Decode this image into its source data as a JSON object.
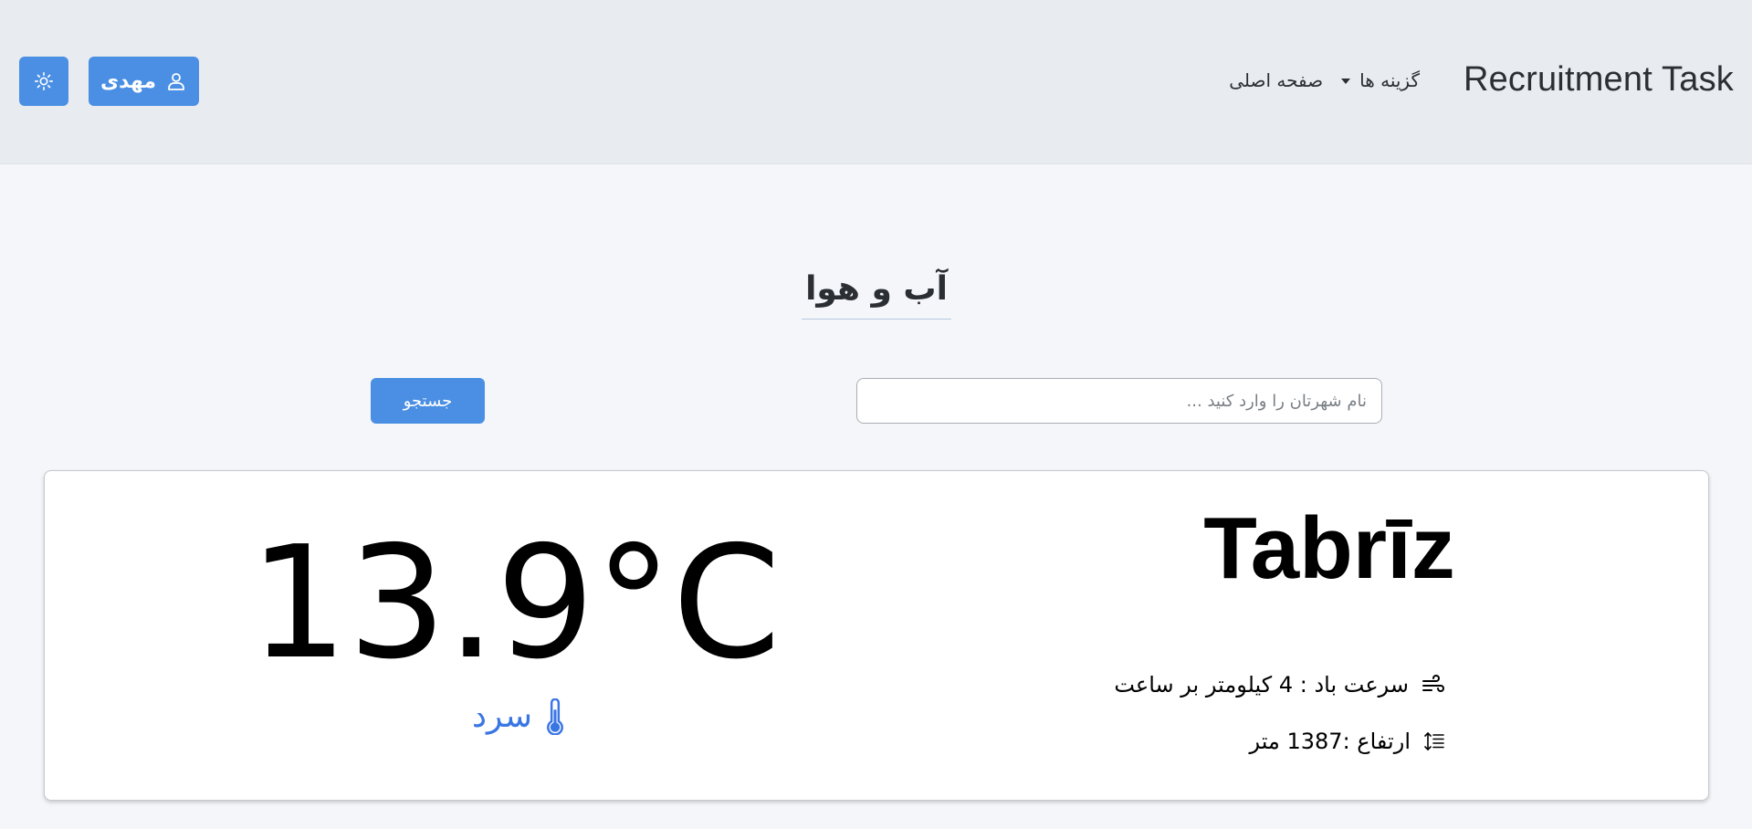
{
  "navbar": {
    "brand": "Recruitment Task",
    "home_link": "صفحه اصلی",
    "options_link": "گزینه ها",
    "user_label": "مهدی",
    "user_icon": "user-icon",
    "theme_icon": "sun-icon"
  },
  "main": {
    "title": "آب و هوا",
    "search": {
      "placeholder": "نام شهرتان را وارد کنید ...",
      "value": "",
      "button_label": "جستجو"
    }
  },
  "weather": {
    "city": "Tabrīz",
    "temperature": "13.9°C",
    "condition": "سرد",
    "condition_icon": "thermometer-icon",
    "wind": "سرعت باد : 4 کیلومتر بر ساعت",
    "wind_icon": "wind-icon",
    "elevation": "ارتفاع :1387 متر",
    "elevation_icon": "elevation-icon"
  },
  "colors": {
    "navbar_bg": "#e8ebef",
    "page_bg": "#f4f6fa",
    "accent": "#4a8fe3",
    "cold": "#3a76e3"
  }
}
